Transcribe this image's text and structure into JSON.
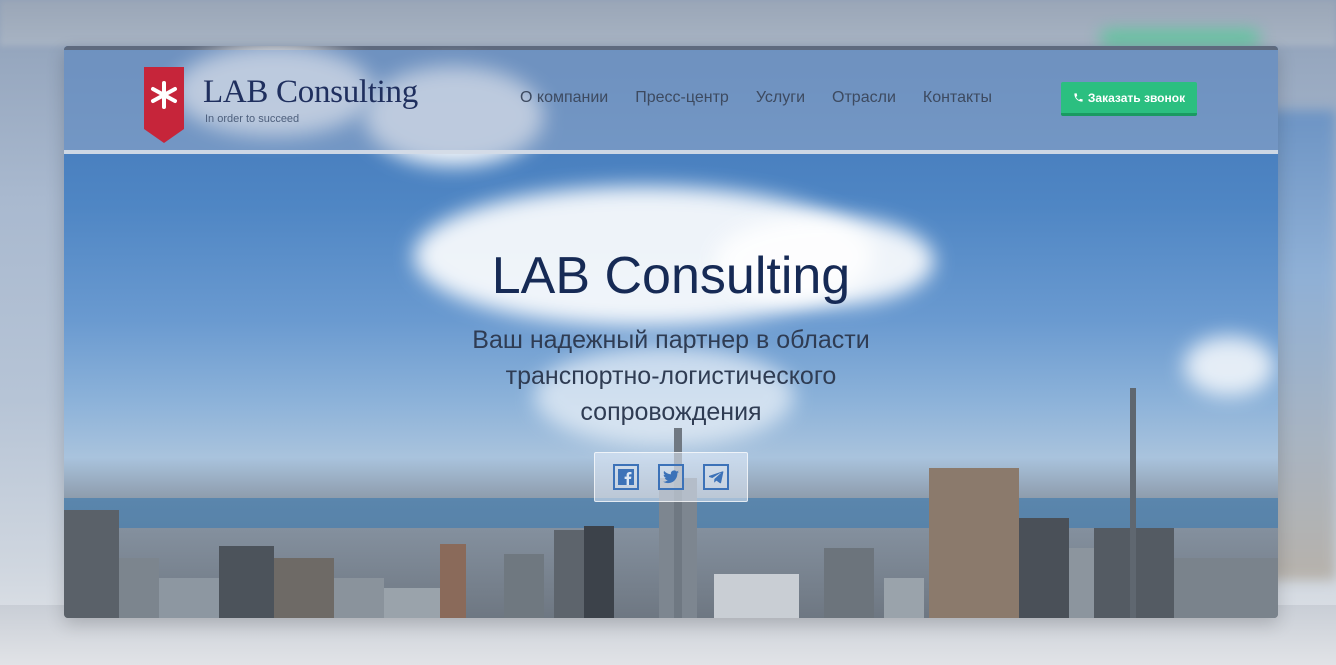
{
  "logo": {
    "symbol": "*",
    "title": "LAB Consulting",
    "tagline": "In order to succeed",
    "flag_color": "#c6253a"
  },
  "nav": {
    "items": [
      {
        "label": "О компании"
      },
      {
        "label": "Пресс-центр"
      },
      {
        "label": "Услуги"
      },
      {
        "label": "Отрасли"
      },
      {
        "label": "Контакты"
      }
    ]
  },
  "cta": {
    "label": "Заказать звонок",
    "icon": "phone-icon",
    "color": "#2bbf80"
  },
  "hero": {
    "title": "LAB Consulting",
    "subtitle_lines": [
      "Ваш надежный партнер в области",
      "транспортно-логистического",
      "сопровождения"
    ]
  },
  "social": {
    "items": [
      {
        "icon": "facebook-icon"
      },
      {
        "icon": "twitter-icon"
      },
      {
        "icon": "telegram-icon"
      }
    ]
  },
  "colors": {
    "title": "#162a55",
    "accent": "#3c72b8"
  }
}
